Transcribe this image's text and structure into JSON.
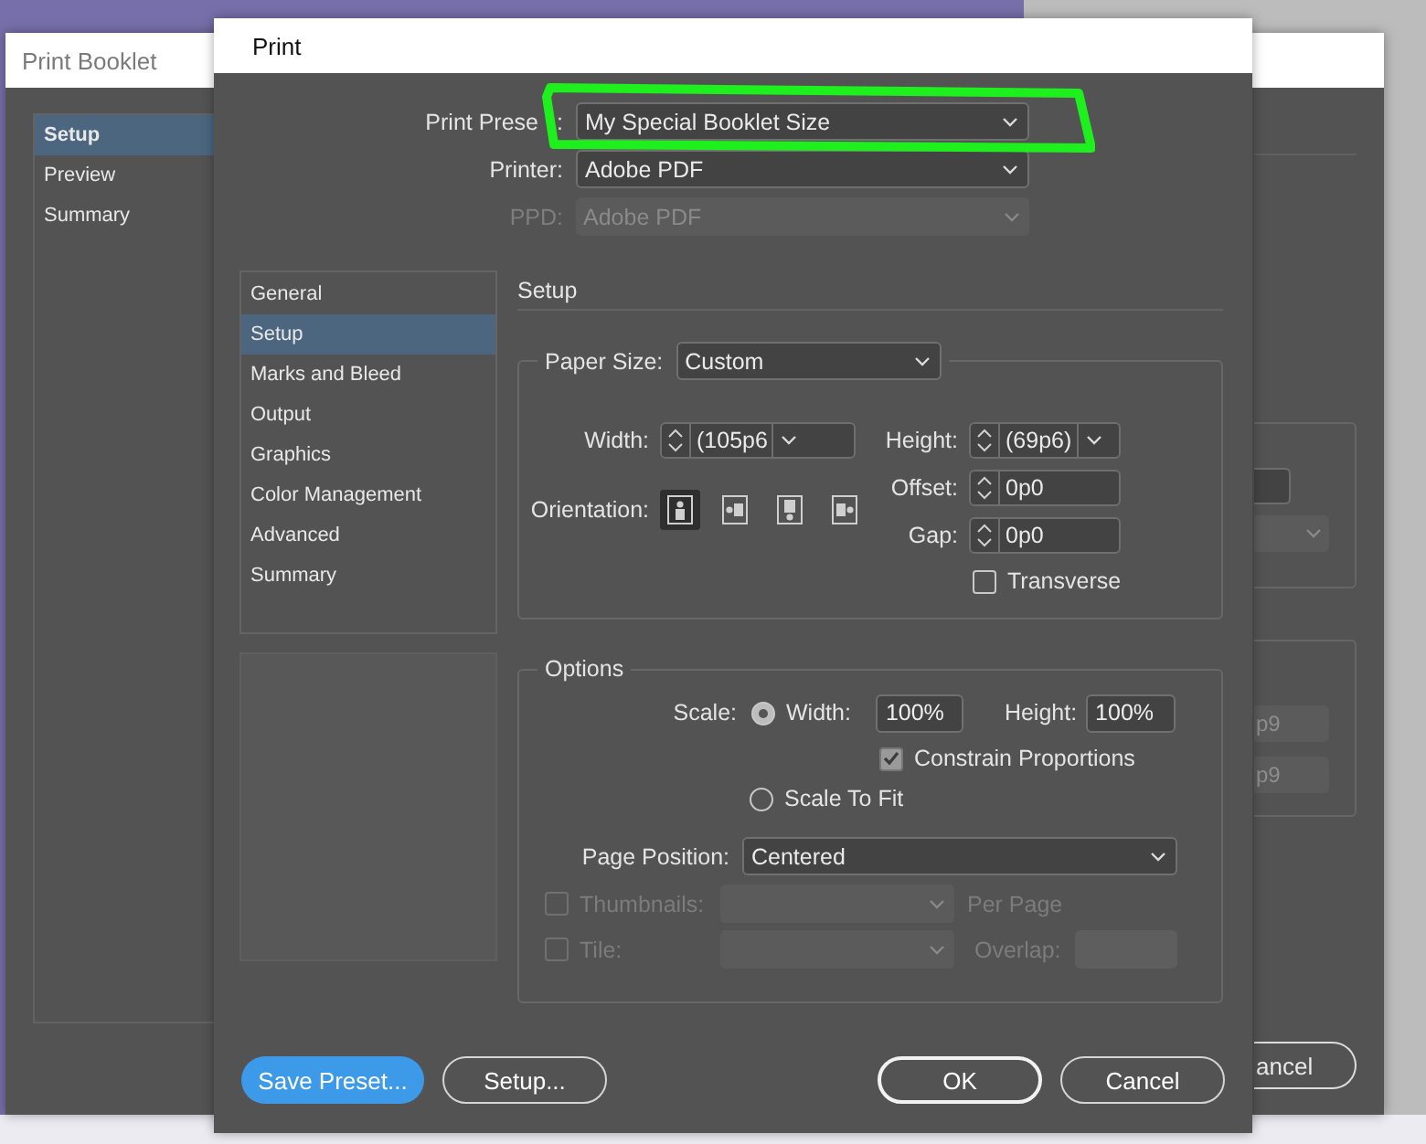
{
  "booklet_window": {
    "title": "Print Booklet",
    "sidebar": [
      {
        "label": "Setup",
        "selected": true
      },
      {
        "label": "Preview",
        "selected": false
      },
      {
        "label": "Summary",
        "selected": false
      }
    ],
    "field_values": [
      "p9",
      "p9"
    ],
    "cancel_button": "ancel"
  },
  "print_dialog": {
    "title": "Print",
    "preset": {
      "label": "Print Prese",
      "label_tail": ":",
      "value": "My Special Booklet Size",
      "highlighted": true
    },
    "printer": {
      "label": "Printer:",
      "value": "Adobe PDF",
      "disabled": false
    },
    "ppd": {
      "label": "PPD:",
      "value": "Adobe PDF",
      "disabled": true
    },
    "categories": [
      {
        "label": "General",
        "selected": false
      },
      {
        "label": "Setup",
        "selected": true
      },
      {
        "label": "Marks and Bleed",
        "selected": false
      },
      {
        "label": "Output",
        "selected": false
      },
      {
        "label": "Graphics",
        "selected": false
      },
      {
        "label": "Color Management",
        "selected": false
      },
      {
        "label": "Advanced",
        "selected": false
      },
      {
        "label": "Summary",
        "selected": false
      }
    ],
    "section_title": "Setup",
    "paper": {
      "label": "Paper Size:",
      "value": "Custom",
      "width": {
        "label": "Width:",
        "value": "(105p6"
      },
      "height": {
        "label": "Height:",
        "value": "(69p6)"
      },
      "orientation": {
        "label": "Orientation:",
        "options": [
          {
            "kind": "portrait",
            "selected": true
          },
          {
            "kind": "landscape",
            "selected": false
          },
          {
            "kind": "reverse-portrait",
            "selected": false
          },
          {
            "kind": "reverse-landscape",
            "selected": false
          }
        ]
      },
      "offset": {
        "label": "Offset:",
        "value": "0p0"
      },
      "gap": {
        "label": "Gap:",
        "value": "0p0"
      },
      "transverse": {
        "label": "Transverse",
        "checked": false
      }
    },
    "options": {
      "title": "Options",
      "scale_label": "Scale:",
      "scale_width": {
        "label": "Width:",
        "value": "100%",
        "selected": true
      },
      "scale_height": {
        "label": "Height:",
        "value": "100%"
      },
      "constrain": {
        "label": "Constrain Proportions",
        "checked": true
      },
      "scale_to_fit": {
        "label": "Scale To Fit",
        "selected": false
      },
      "page_position": {
        "label": "Page Position:",
        "value": "Centered"
      },
      "thumbnails": {
        "label": "Thumbnails:",
        "checked": false,
        "disabled": true,
        "suffix": "Per Page"
      },
      "tile": {
        "label": "Tile:",
        "checked": false,
        "disabled": true,
        "suffix": "Overlap:"
      }
    },
    "buttons": [
      {
        "label": "Save Preset...",
        "kind": "primary"
      },
      {
        "label": "Setup...",
        "kind": "secondary"
      },
      {
        "label": "OK",
        "kind": "default"
      },
      {
        "label": "Cancel",
        "kind": "secondary"
      }
    ]
  }
}
